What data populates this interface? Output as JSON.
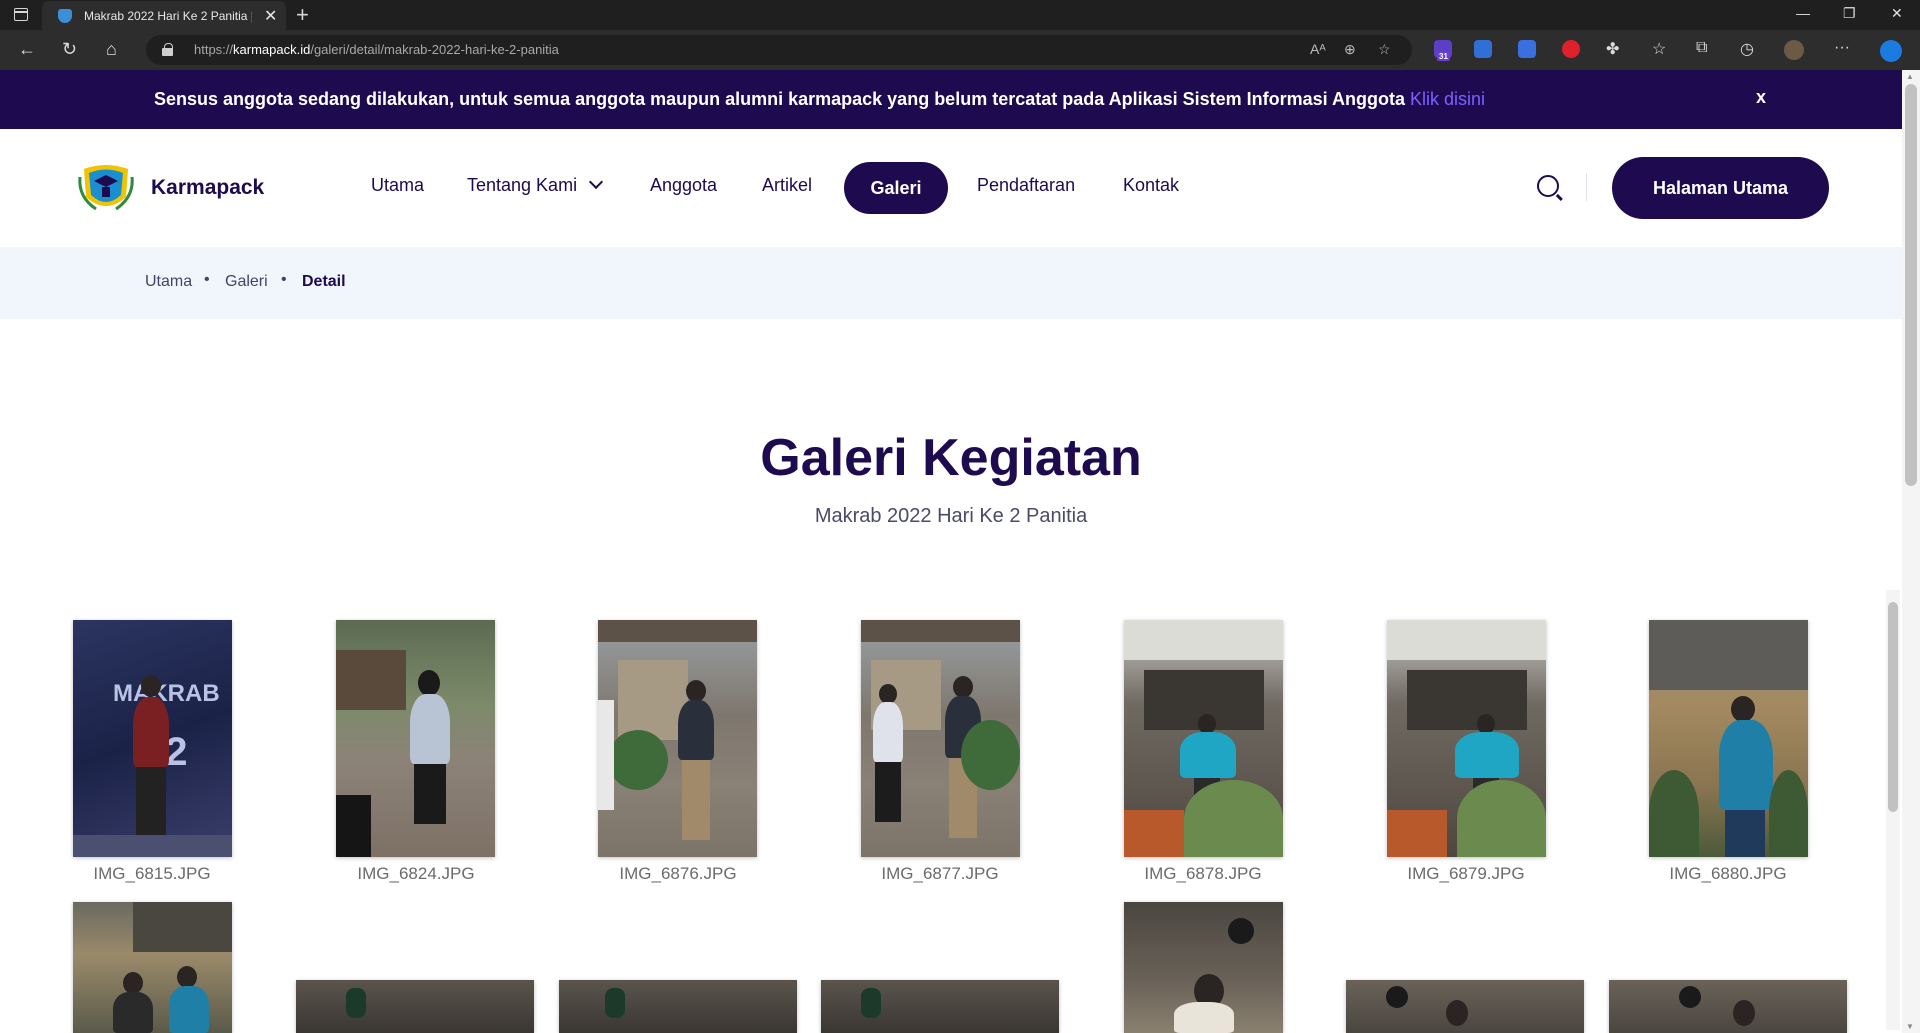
{
  "browser": {
    "tab_title": "Makrab 2022 Hari Ke 2 Panitia | K",
    "url_prefix": "https://",
    "url_host": "karmapack.id",
    "url_path": "/galeri/detail/makrab-2022-hari-ke-2-panitia",
    "ext_badge": "31"
  },
  "announcement": {
    "text": "Sensus anggota sedang dilakukan, untuk semua anggota maupun alumni karmapack yang belum tercatat pada Aplikasi Sistem Informasi Anggota ",
    "link": "Klik disini",
    "close": "x"
  },
  "header": {
    "brand": "Karmapack",
    "nav": [
      "Utama",
      "Tentang Kami",
      "Anggota",
      "Artikel",
      "Galeri",
      "Pendaftaran",
      "Kontak"
    ],
    "cta": "Halaman Utama"
  },
  "breadcrumb": [
    "Utama",
    "Galeri",
    "Detail"
  ],
  "page": {
    "title": "Galeri Kegiatan",
    "subtitle": "Makrab 2022 Hari Ke 2 Panitia"
  },
  "gallery": [
    "IMG_6815.JPG",
    "IMG_6824.JPG",
    "IMG_6876.JPG",
    "IMG_6877.JPG",
    "IMG_6878.JPG",
    "IMG_6879.JPG",
    "IMG_6880.JPG"
  ],
  "colors": {
    "brand": "#1e0a4e",
    "link": "#7b61ff",
    "breadcrumb_bg": "#f1f5fc"
  }
}
